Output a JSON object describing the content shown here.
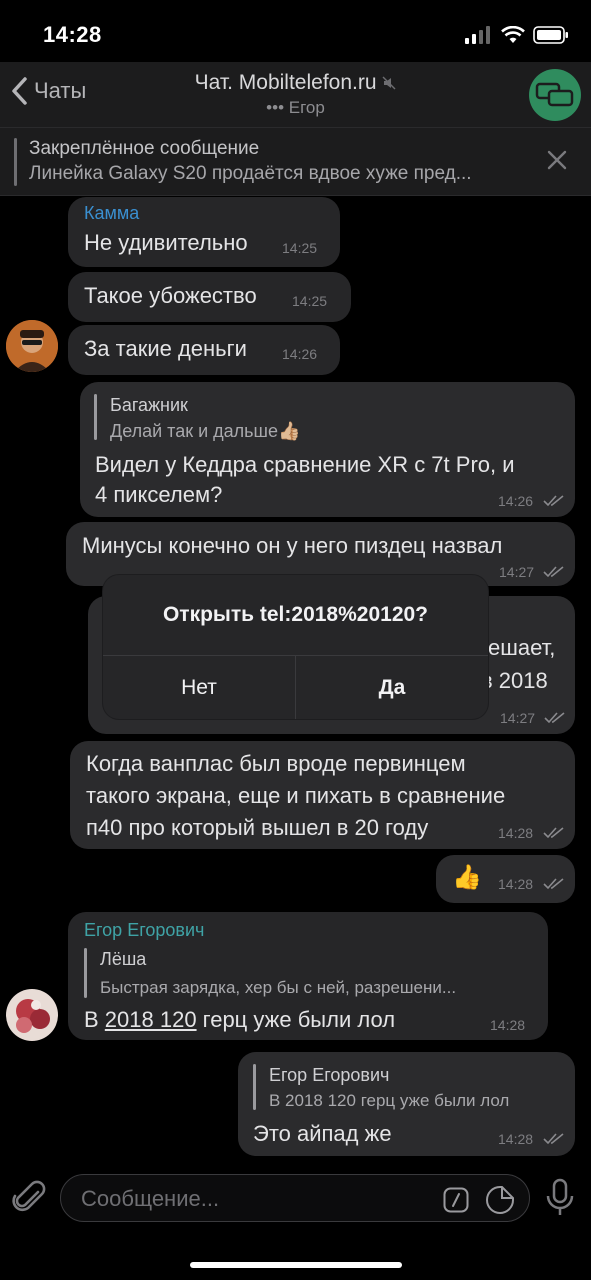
{
  "status": {
    "time": "14:28"
  },
  "header": {
    "back_label": "Чаты",
    "title": "Чат. Mobiltelefon.ru",
    "subtitle": "••• Егор",
    "accent": "#2f8c5e"
  },
  "pinned": {
    "title": "Закреплённое сообщение",
    "text": "Линейка Galaxy S20 продаётся вдвое хуже пред..."
  },
  "messages": [
    {
      "sender": "Камма",
      "text": "Не удивительно",
      "time": "14:25"
    },
    {
      "text": "Такое убожество",
      "time": "14:25"
    },
    {
      "text": "За такие деньги",
      "time": "14:26"
    },
    {
      "reply_name": "Багажник",
      "reply_text": "Делай так и дальше👍🏼",
      "line1": "Видел у Кеддра сравнение XR с 7t Pro, и",
      "line2": "4 пикселем?",
      "time": "14:26"
    },
    {
      "text": "Минусы конечно он у него пиздец назвал",
      "time": "14:27"
    },
    {
      "fragment1": "ешает,",
      "fragment2": "в 2018",
      "time": "14:27"
    },
    {
      "line1": "Когда ванплас был вроде первинцем",
      "line2": "такого экрана, еще и пихать в сравнение",
      "line3": "п40 про который вышел в 20 году",
      "time": "14:28"
    },
    {
      "emoji": "👍",
      "time": "14:28"
    },
    {
      "sender": "Егор Егорович",
      "reply_name": "Лёша",
      "reply_text": "Быстрая зарядка, хер бы с ней, разрешени...",
      "link": "2018 120",
      "text_prefix": "В ",
      "text_suffix": " герц уже были лол",
      "time": "14:28"
    },
    {
      "reply_name": "Егор Егорович",
      "reply_text": "В 2018 120 герц уже были лол",
      "text": "Это айпад же",
      "time": "14:28"
    }
  ],
  "dialog": {
    "title": "Открыть tel:2018%20120?",
    "no_label": "Нет",
    "yes_label": "Да"
  },
  "input": {
    "placeholder": "Сообщение..."
  },
  "colors": {
    "sender_orange": "#3a8fd0",
    "sender_teal": "#3fa3a6"
  }
}
